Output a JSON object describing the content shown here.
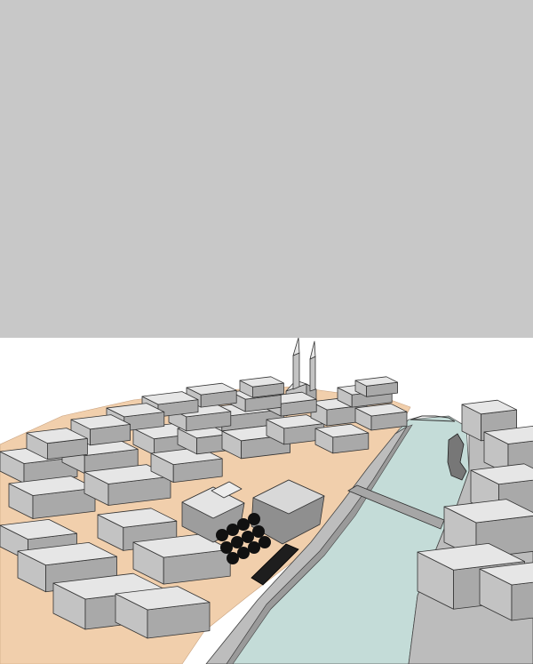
{
  "colors": {
    "top_panel": "#c8c8c8",
    "sky": "#ffffff",
    "ground": "#f1cfac",
    "water": "#c4dcd8",
    "roof": "#e6e6e6",
    "wall": "#b4b4b4",
    "outline": "#333333",
    "trees": "#111111"
  }
}
